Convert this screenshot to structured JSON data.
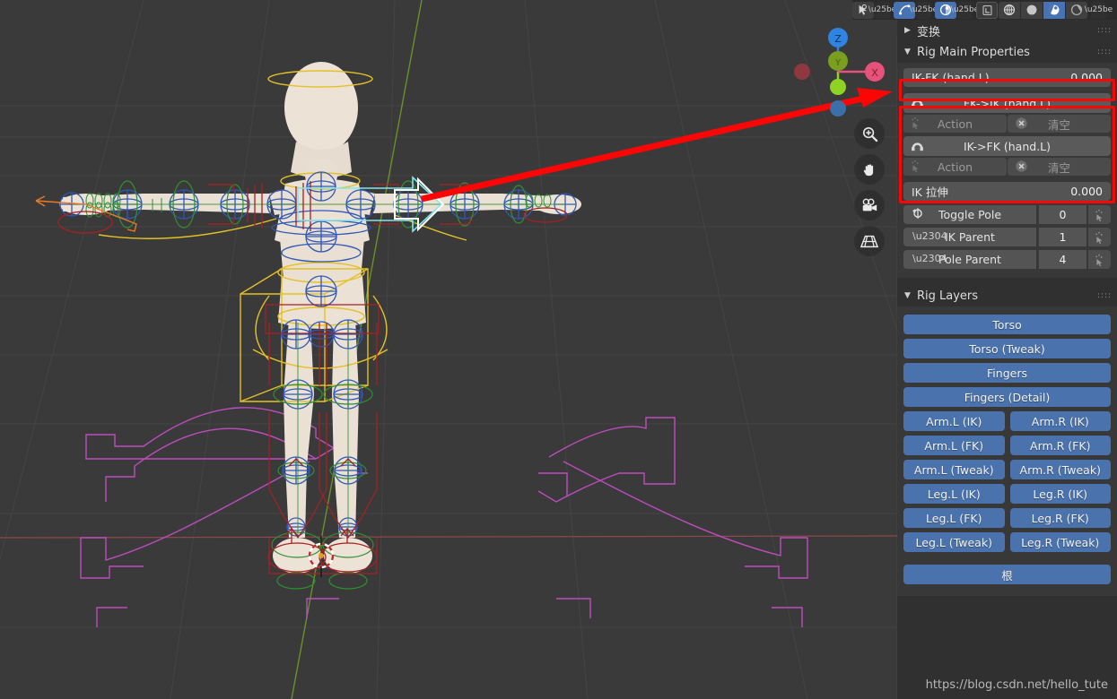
{
  "topbar": {
    "icons": [
      {
        "name": "object-mode-dropdown-icon",
        "glyph": "➤",
        "active": false,
        "chev": true
      },
      {
        "name": "pose-options-icon",
        "glyph": "⤴",
        "active": true,
        "chev": true
      },
      {
        "name": "snapping-icon",
        "glyph": "◔",
        "active": true,
        "chev": true
      }
    ],
    "gizmo_icon": "gizmo-toggle-icon",
    "shading_modes": [
      {
        "name": "shading-wireframe-icon",
        "active": false
      },
      {
        "name": "shading-solid-icon",
        "active": false
      },
      {
        "name": "shading-material-preview-icon",
        "active": true
      },
      {
        "name": "shading-rendered-icon",
        "active": false
      }
    ],
    "shading_chevron": "chevron-down-icon"
  },
  "viewport": {
    "gizmo": {
      "axes": [
        {
          "label": "Z",
          "color": "#2f83e3",
          "filled": true
        },
        {
          "label": "Y",
          "color": "#7a9e1e",
          "filled": true
        },
        {
          "label": "X",
          "color": "#e8527a",
          "filled": true
        },
        {
          "label": "",
          "color": "#8fd424",
          "filled": true
        },
        {
          "label": "",
          "color": "#3a6fa8",
          "filled": true
        },
        {
          "label": "",
          "color": "#8e3840",
          "filled": true
        }
      ]
    },
    "nav_buttons": [
      {
        "name": "zoom-view-icon",
        "label": "zoom"
      },
      {
        "name": "pan-view-icon",
        "label": "hand"
      },
      {
        "name": "camera-view-icon",
        "label": "camera"
      },
      {
        "name": "toggle-perspective-icon",
        "label": "grid"
      }
    ],
    "annotation_arrow_color": "#fb0505"
  },
  "sidepanel": {
    "transform_panel": {
      "title": "变换",
      "expanded": false,
      "triangle": "▶",
      "grip": "grip-icon"
    },
    "rig_main": {
      "title": "Rig Main Properties",
      "expanded": true,
      "triangle": "▼",
      "grip": "grip-icon",
      "ikfk": {
        "label": "IK-FK (hand.L)",
        "value": "0.000",
        "highlighted": true
      },
      "snap_ops": [
        {
          "name": "fk-to-ik",
          "label": "FK->IK (hand.L)",
          "icon": "snap-magnet-icon",
          "action_label": "Action",
          "action_icon": "animate-decorator-icon",
          "clear_label": "清空",
          "clear_icon": "clear-x-icon"
        },
        {
          "name": "ik-to-fk",
          "label": "IK->FK (hand.L)",
          "icon": "snap-magnet-icon",
          "action_label": "Action",
          "action_icon": "animate-decorator-icon",
          "clear_label": "清空",
          "clear_icon": "clear-x-icon"
        }
      ],
      "ik_stretch": {
        "label": "IK 拉伸",
        "value": "0.000"
      },
      "toggle_pole": {
        "label": "Toggle Pole",
        "value": "0",
        "icon": "toggle-pole-icon",
        "anim_icon": "animate-decorator-icon"
      },
      "ik_parent": {
        "label": "IK Parent",
        "value": "1",
        "icon": "chevron-down-icon",
        "anim_icon": "animate-decorator-icon"
      },
      "pole_parent": {
        "label": "Pole Parent",
        "value": "4",
        "icon": "chevron-down-icon",
        "anim_icon": "animate-decorator-icon"
      }
    },
    "rig_layers": {
      "title": "Rig Layers",
      "expanded": true,
      "triangle": "▼",
      "grip": "grip-icon",
      "accent_color": "#4a72ac",
      "full_rows": [
        "Torso",
        "Torso (Tweak)",
        "Fingers",
        "Fingers (Detail)"
      ],
      "paired_rows": [
        [
          "Arm.L (IK)",
          "Arm.R (IK)"
        ],
        [
          "Arm.L (FK)",
          "Arm.R (FK)"
        ],
        [
          "Arm.L (Tweak)",
          "Arm.R (Tweak)"
        ],
        [
          "Leg.L (IK)",
          "Leg.R (IK)"
        ],
        [
          "Leg.L (FK)",
          "Leg.R (FK)"
        ],
        [
          "Leg.L (Tweak)",
          "Leg.R (Tweak)"
        ]
      ],
      "root_row": "根"
    }
  },
  "watermark": "https://blog.csdn.net/hello_tute"
}
